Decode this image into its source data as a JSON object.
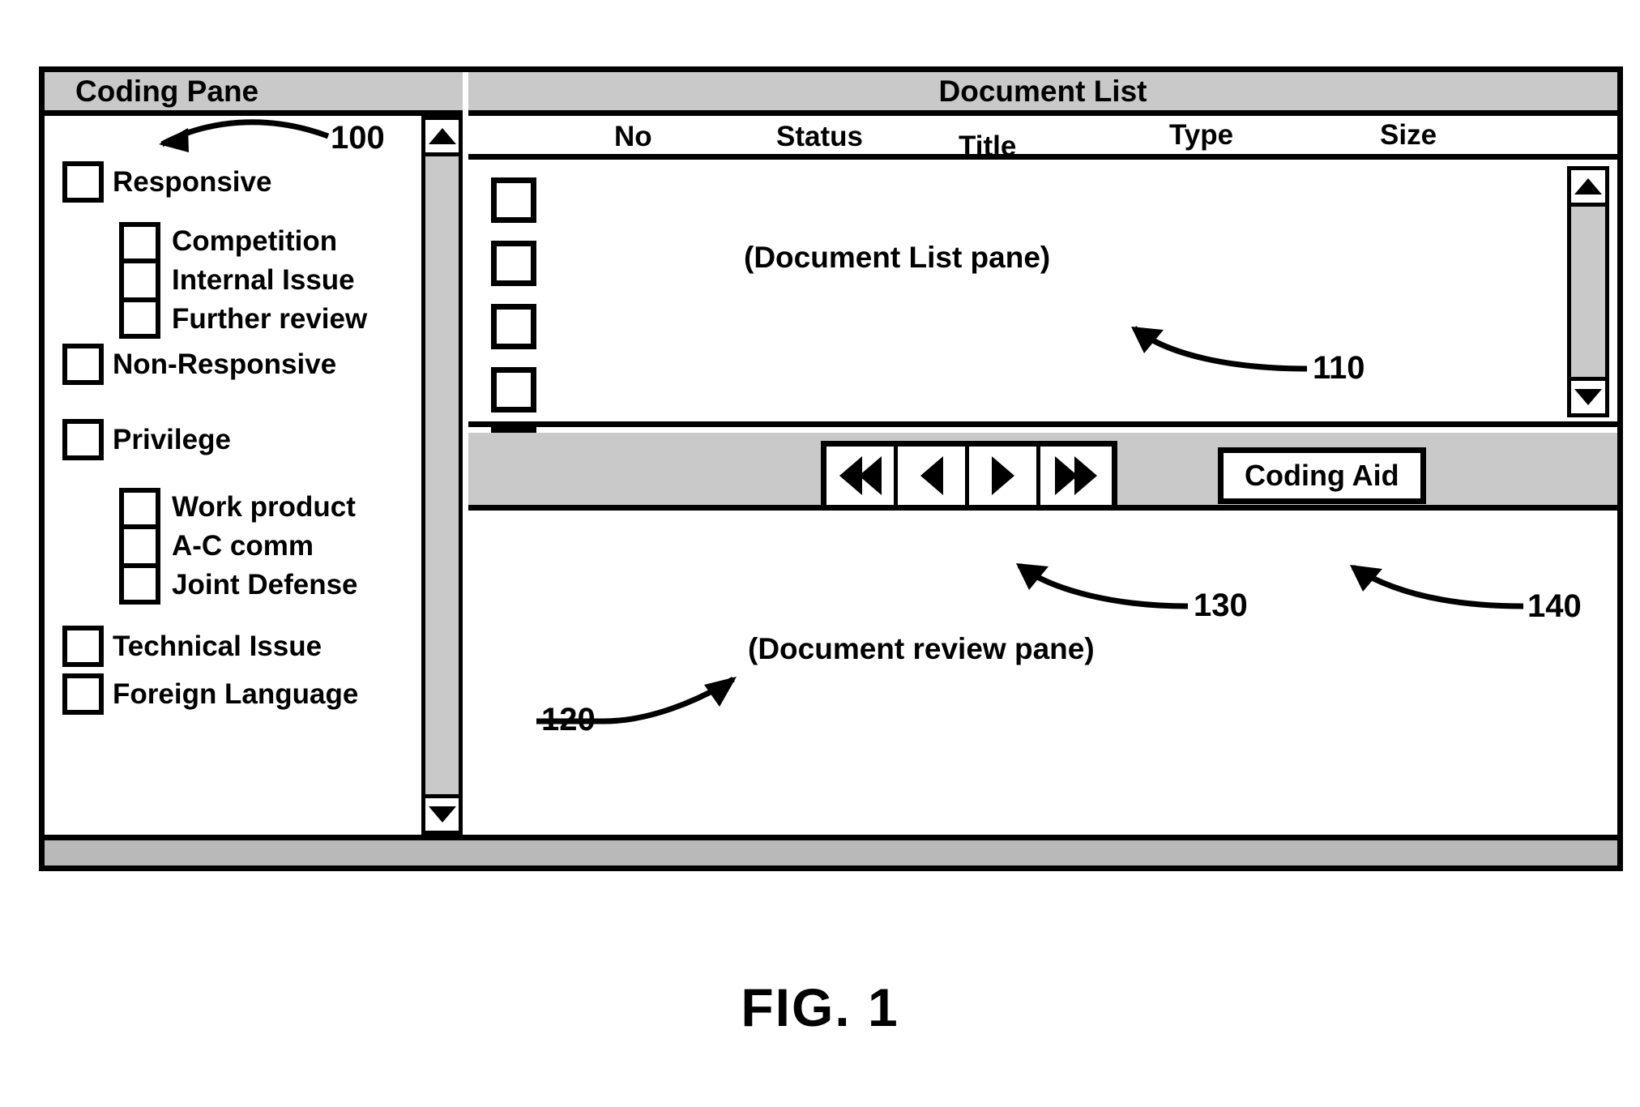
{
  "figure": {
    "caption": "FIG. 1"
  },
  "coding_pane": {
    "title": "Coding Pane",
    "items": [
      {
        "label": "Responsive",
        "checked": false
      },
      {
        "label": "Non-Responsive",
        "checked": false
      },
      {
        "label": "Privilege",
        "checked": false
      },
      {
        "label": "Technical Issue",
        "checked": false
      },
      {
        "label": "Foreign Language",
        "checked": false
      }
    ],
    "responsive_sub": [
      {
        "label": "Competition",
        "checked": false
      },
      {
        "label": "Internal Issue",
        "checked": false
      },
      {
        "label": "Further review",
        "checked": false
      }
    ],
    "privilege_sub": [
      {
        "label": "Work product",
        "checked": false
      },
      {
        "label": "A-C comm",
        "checked": false
      },
      {
        "label": "Joint Defense",
        "checked": false
      }
    ]
  },
  "document_list": {
    "title": "Document List",
    "columns": [
      "No",
      "Status",
      "Title",
      "Type",
      "Size"
    ],
    "pane_caption": "(Document List pane)",
    "row_count": 5
  },
  "toolbar": {
    "nav_buttons": [
      {
        "name": "first",
        "glyph": "first-page-icon"
      },
      {
        "name": "previous",
        "glyph": "previous-page-icon"
      },
      {
        "name": "next",
        "glyph": "next-page-icon"
      },
      {
        "name": "last",
        "glyph": "last-page-icon"
      }
    ],
    "coding_aid_label": "Coding Aid"
  },
  "review_pane": {
    "caption": "(Document review pane)"
  },
  "callouts": [
    {
      "id": "100",
      "label": "100",
      "target": "coding-pane"
    },
    {
      "id": "110",
      "label": "110",
      "target": "document-list-pane"
    },
    {
      "id": "120",
      "label": "120",
      "target": "document-review-pane"
    },
    {
      "id": "130",
      "label": "130",
      "target": "navigation-buttons"
    },
    {
      "id": "140",
      "label": "140",
      "target": "coding-aid-button"
    }
  ],
  "colors": {
    "line": "#000000",
    "titlebar_fill": "#c9c9c9",
    "scroll_track": "#c9c9c9",
    "statusbar_fill": "#b9b9b9",
    "pane_fill": "#ffffff"
  }
}
